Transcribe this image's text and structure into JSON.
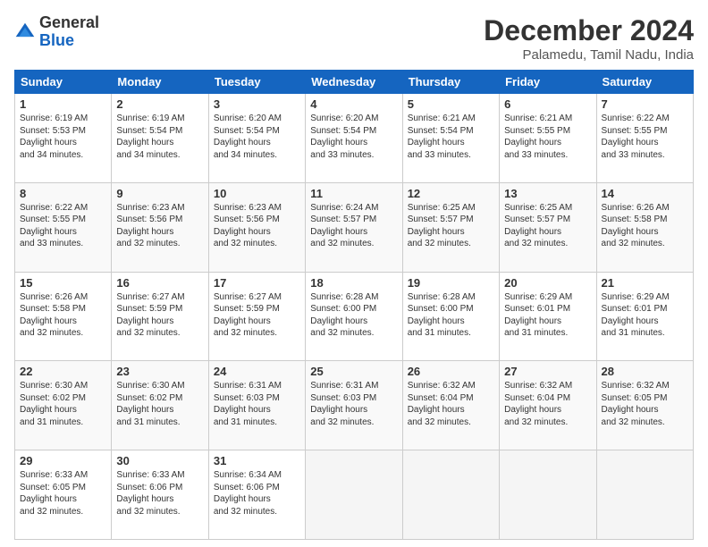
{
  "header": {
    "logo_general": "General",
    "logo_blue": "Blue",
    "month_title": "December 2024",
    "subtitle": "Palamedu, Tamil Nadu, India"
  },
  "weekdays": [
    "Sunday",
    "Monday",
    "Tuesday",
    "Wednesday",
    "Thursday",
    "Friday",
    "Saturday"
  ],
  "weeks": [
    [
      {
        "day": "1",
        "sunrise": "6:19 AM",
        "sunset": "5:53 PM",
        "daylight": "11 hours and 34 minutes."
      },
      {
        "day": "2",
        "sunrise": "6:19 AM",
        "sunset": "5:54 PM",
        "daylight": "11 hours and 34 minutes."
      },
      {
        "day": "3",
        "sunrise": "6:20 AM",
        "sunset": "5:54 PM",
        "daylight": "11 hours and 34 minutes."
      },
      {
        "day": "4",
        "sunrise": "6:20 AM",
        "sunset": "5:54 PM",
        "daylight": "11 hours and 33 minutes."
      },
      {
        "day": "5",
        "sunrise": "6:21 AM",
        "sunset": "5:54 PM",
        "daylight": "11 hours and 33 minutes."
      },
      {
        "day": "6",
        "sunrise": "6:21 AM",
        "sunset": "5:55 PM",
        "daylight": "11 hours and 33 minutes."
      },
      {
        "day": "7",
        "sunrise": "6:22 AM",
        "sunset": "5:55 PM",
        "daylight": "11 hours and 33 minutes."
      }
    ],
    [
      {
        "day": "8",
        "sunrise": "6:22 AM",
        "sunset": "5:55 PM",
        "daylight": "11 hours and 33 minutes."
      },
      {
        "day": "9",
        "sunrise": "6:23 AM",
        "sunset": "5:56 PM",
        "daylight": "11 hours and 32 minutes."
      },
      {
        "day": "10",
        "sunrise": "6:23 AM",
        "sunset": "5:56 PM",
        "daylight": "11 hours and 32 minutes."
      },
      {
        "day": "11",
        "sunrise": "6:24 AM",
        "sunset": "5:57 PM",
        "daylight": "11 hours and 32 minutes."
      },
      {
        "day": "12",
        "sunrise": "6:25 AM",
        "sunset": "5:57 PM",
        "daylight": "11 hours and 32 minutes."
      },
      {
        "day": "13",
        "sunrise": "6:25 AM",
        "sunset": "5:57 PM",
        "daylight": "11 hours and 32 minutes."
      },
      {
        "day": "14",
        "sunrise": "6:26 AM",
        "sunset": "5:58 PM",
        "daylight": "11 hours and 32 minutes."
      }
    ],
    [
      {
        "day": "15",
        "sunrise": "6:26 AM",
        "sunset": "5:58 PM",
        "daylight": "11 hours and 32 minutes."
      },
      {
        "day": "16",
        "sunrise": "6:27 AM",
        "sunset": "5:59 PM",
        "daylight": "11 hours and 32 minutes."
      },
      {
        "day": "17",
        "sunrise": "6:27 AM",
        "sunset": "5:59 PM",
        "daylight": "11 hours and 32 minutes."
      },
      {
        "day": "18",
        "sunrise": "6:28 AM",
        "sunset": "6:00 PM",
        "daylight": "11 hours and 32 minutes."
      },
      {
        "day": "19",
        "sunrise": "6:28 AM",
        "sunset": "6:00 PM",
        "daylight": "11 hours and 31 minutes."
      },
      {
        "day": "20",
        "sunrise": "6:29 AM",
        "sunset": "6:01 PM",
        "daylight": "11 hours and 31 minutes."
      },
      {
        "day": "21",
        "sunrise": "6:29 AM",
        "sunset": "6:01 PM",
        "daylight": "11 hours and 31 minutes."
      }
    ],
    [
      {
        "day": "22",
        "sunrise": "6:30 AM",
        "sunset": "6:02 PM",
        "daylight": "11 hours and 31 minutes."
      },
      {
        "day": "23",
        "sunrise": "6:30 AM",
        "sunset": "6:02 PM",
        "daylight": "11 hours and 31 minutes."
      },
      {
        "day": "24",
        "sunrise": "6:31 AM",
        "sunset": "6:03 PM",
        "daylight": "11 hours and 31 minutes."
      },
      {
        "day": "25",
        "sunrise": "6:31 AM",
        "sunset": "6:03 PM",
        "daylight": "11 hours and 32 minutes."
      },
      {
        "day": "26",
        "sunrise": "6:32 AM",
        "sunset": "6:04 PM",
        "daylight": "11 hours and 32 minutes."
      },
      {
        "day": "27",
        "sunrise": "6:32 AM",
        "sunset": "6:04 PM",
        "daylight": "11 hours and 32 minutes."
      },
      {
        "day": "28",
        "sunrise": "6:32 AM",
        "sunset": "6:05 PM",
        "daylight": "11 hours and 32 minutes."
      }
    ],
    [
      {
        "day": "29",
        "sunrise": "6:33 AM",
        "sunset": "6:05 PM",
        "daylight": "11 hours and 32 minutes."
      },
      {
        "day": "30",
        "sunrise": "6:33 AM",
        "sunset": "6:06 PM",
        "daylight": "11 hours and 32 minutes."
      },
      {
        "day": "31",
        "sunrise": "6:34 AM",
        "sunset": "6:06 PM",
        "daylight": "11 hours and 32 minutes."
      },
      null,
      null,
      null,
      null
    ]
  ]
}
